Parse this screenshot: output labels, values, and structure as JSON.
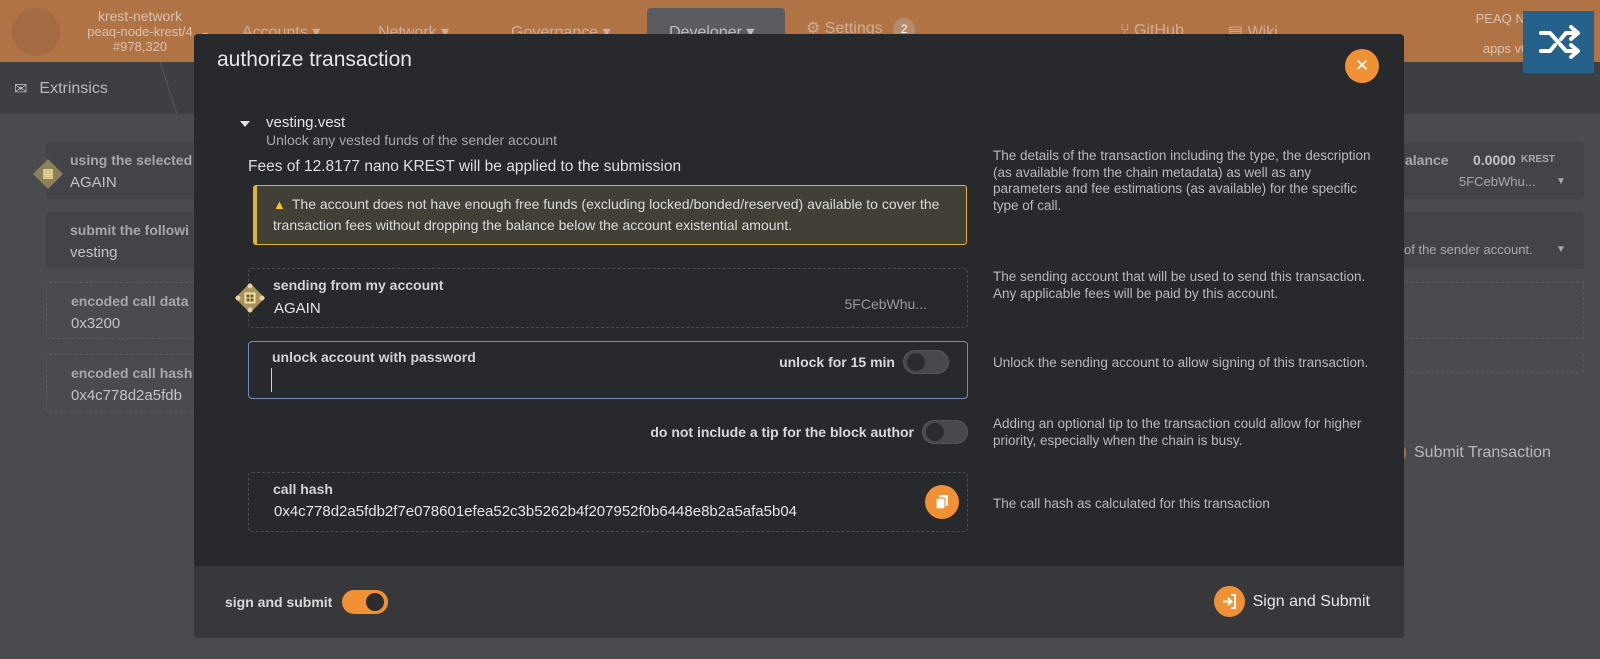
{
  "topbar": {
    "chain_name": "krest-network",
    "node_name": "peaq-node-krest/4",
    "block": "#978,320",
    "nav": [
      "Accounts",
      "Network",
      "Governance",
      "Developer",
      "Settings"
    ],
    "settings_badge": "2",
    "github": "GitHub",
    "wiki": "Wiki",
    "node_info": [
      "PEAQ No",
      "a",
      "apps v0."
    ]
  },
  "subbar": {
    "tab": "Extrinsics"
  },
  "background": {
    "using_label": "using the selected",
    "using_value": "AGAIN",
    "submit_label": "submit the followi",
    "submit_value": "vesting",
    "encoded_label": "encoded call data",
    "encoded_value": "0x3200",
    "hash_label": "encoded call hash",
    "hash_value": "0x4c778d2a5fdb",
    "balance_label": "alance",
    "balance_value": "0.0000",
    "balance_unit": "KREST",
    "balance_addr": "5FCebWhu...",
    "call_desc": "of the sender account.",
    "submit_tx": "Submit Transaction"
  },
  "modal": {
    "title": "authorize transaction",
    "call": {
      "name": "vesting.vest",
      "description": "Unlock any vested funds of the sender account"
    },
    "fees": "Fees of 12.8177 nano KREST will be applied to the submission",
    "warning": "The account does not have enough free funds (excluding locked/bonded/reserved) available to cover the transaction fees without dropping the balance below the account existential amount.",
    "sending": {
      "label": "sending from my account",
      "account": "AGAIN",
      "address": "5FCebWhu..."
    },
    "password": {
      "label": "unlock account with password",
      "value": "",
      "unlock_label": "unlock for 15 min"
    },
    "tip_label": "do not include a tip for the block author",
    "call_hash": {
      "label": "call hash",
      "value": "0x4c778d2a5fdb2f7e078601efea52c3b5262b4f207952f0b6448e8b2a5afa5b04"
    },
    "help": {
      "details": "The details of the transaction including the type, the description (as available from the chain metadata) as well as any parameters and fee estimations (as available) for the specific type of call.",
      "sending": "The sending account that will be used to send this transaction. Any applicable fees will be paid by this account.",
      "unlock": "Unlock the sending account to allow signing of this transaction.",
      "tip": "Adding an optional tip to the transaction could allow for higher priority, especially when the chain is busy.",
      "hash": "The call hash as calculated for this transaction"
    },
    "footer": {
      "sign_label": "sign and submit",
      "submit_label": "Sign and Submit"
    }
  },
  "colors": {
    "accent": "#f19135",
    "warning_border": "#e0b43a",
    "modal_bg": "#28292d"
  }
}
